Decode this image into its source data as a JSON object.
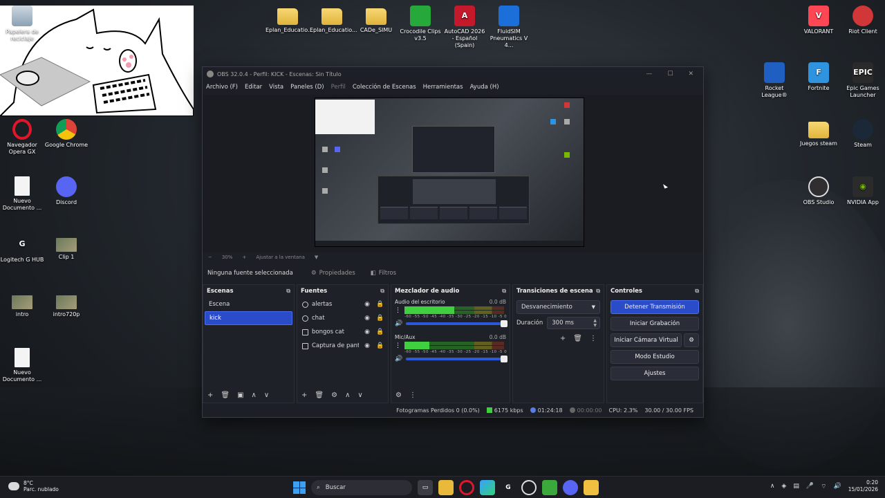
{
  "desktop": {
    "icons_left": [
      {
        "label": "Papelera de reciclaje",
        "icon": "recycle-bin-icon"
      },
      {
        "label": "Navegador Opera GX",
        "icon": "opera-gx-icon"
      },
      {
        "label": "Google Chrome",
        "icon": "chrome-icon"
      },
      {
        "label": "Nuevo Documento ...",
        "icon": "document-icon"
      },
      {
        "label": "Discord",
        "icon": "discord-icon"
      },
      {
        "label": "Logitech G HUB",
        "icon": "logitech-icon"
      },
      {
        "label": "Clip 1",
        "icon": "video-icon"
      },
      {
        "label": "intro",
        "icon": "video-icon"
      },
      {
        "label": "intro720p",
        "icon": "video-icon"
      },
      {
        "label": "Nuevo Documento ...",
        "icon": "document-icon"
      }
    ],
    "icons_top": [
      {
        "label": "Eplan_Educatio...",
        "icon": "folder-icon"
      },
      {
        "label": "Eplan_Educatio...",
        "icon": "folder-icon"
      },
      {
        "label": "CADe_SIMU",
        "icon": "folder-icon"
      },
      {
        "label": "Crocodile Clips v3.5",
        "icon": "crocodile-icon"
      },
      {
        "label": "AutoCAD 2026 - Español (Spain)",
        "icon": "autocad-icon"
      },
      {
        "label": "FluidSIM Pneumatics V 4...",
        "icon": "fluidsim-icon"
      }
    ],
    "icons_right": [
      {
        "label": "VALORANT",
        "icon": "valorant-icon"
      },
      {
        "label": "Riot Client",
        "icon": "riot-icon"
      },
      {
        "label": "Rocket League®",
        "icon": "rocket-league-icon"
      },
      {
        "label": "Fortnite",
        "icon": "fortnite-icon"
      },
      {
        "label": "Epic Games Launcher",
        "icon": "epic-icon"
      },
      {
        "label": "Juegos steam",
        "icon": "folder-icon"
      },
      {
        "label": "Steam",
        "icon": "steam-icon"
      },
      {
        "label": "OBS Studio",
        "icon": "obs-icon"
      },
      {
        "label": "NVIDIA App",
        "icon": "nvidia-icon"
      }
    ]
  },
  "obs": {
    "title": "OBS 32.0.4 - Perfil: KICK - Escenas: Sin Título",
    "menu": [
      "Archivo (F)",
      "Editar",
      "Vista",
      "Paneles (D)",
      "Perfil",
      "Colección de Escenas",
      "Herramientas",
      "Ayuda (H)"
    ],
    "zoom": {
      "minus": "−",
      "value": "30%",
      "plus": "+",
      "fit": "Ajustar a la ventana"
    },
    "source_bar": {
      "no_source": "Ninguna fuente seleccionada",
      "properties": "Propiedades",
      "filters": "Filtros"
    },
    "scenes": {
      "title": "Escenas",
      "items": [
        "Escena",
        "kick"
      ],
      "selected": "kick"
    },
    "sources": {
      "title": "Fuentes",
      "items": [
        "alertas",
        "chat",
        "bongos cat",
        "Captura de pantalla"
      ]
    },
    "mixer": {
      "title": "Mezclador de audio",
      "channels": [
        {
          "name": "Audio del escritorio",
          "db": "0.0 dB",
          "level": 0.5
        },
        {
          "name": "Mic/Aux",
          "db": "0.0 dB",
          "level": 0.25
        }
      ],
      "ticks": "-60 -55 -50 -45 -40 -35 -30 -25 -20 -15 -10 -5 0"
    },
    "transitions": {
      "title": "Transiciones de escena",
      "selected": "Desvanecimiento",
      "duration_label": "Duración",
      "duration": "300 ms"
    },
    "controls": {
      "title": "Controles",
      "stop_stream": "Detener Transmisión",
      "start_record": "Iniciar Grabación",
      "virtual_cam": "Iniciar Cámara Virtual",
      "studio_mode": "Modo Estudio",
      "settings": "Ajustes"
    },
    "status": {
      "dropped": "Fotogramas Perdidos 0 (0.0%)",
      "bitrate": "6175 kbps",
      "stream_time": "01:24:18",
      "rec_time": "00:00:00",
      "cpu": "CPU: 2.3%",
      "fps": "30.00 / 30.00 FPS"
    }
  },
  "taskbar": {
    "weather_temp": "8°C",
    "weather_desc": "Parc. nublado",
    "search": "Buscar",
    "time": "0:20",
    "date": "15/01/2026"
  },
  "colors": {
    "accent": "#2b4cc8",
    "obs_bg": "#1d1f26"
  }
}
